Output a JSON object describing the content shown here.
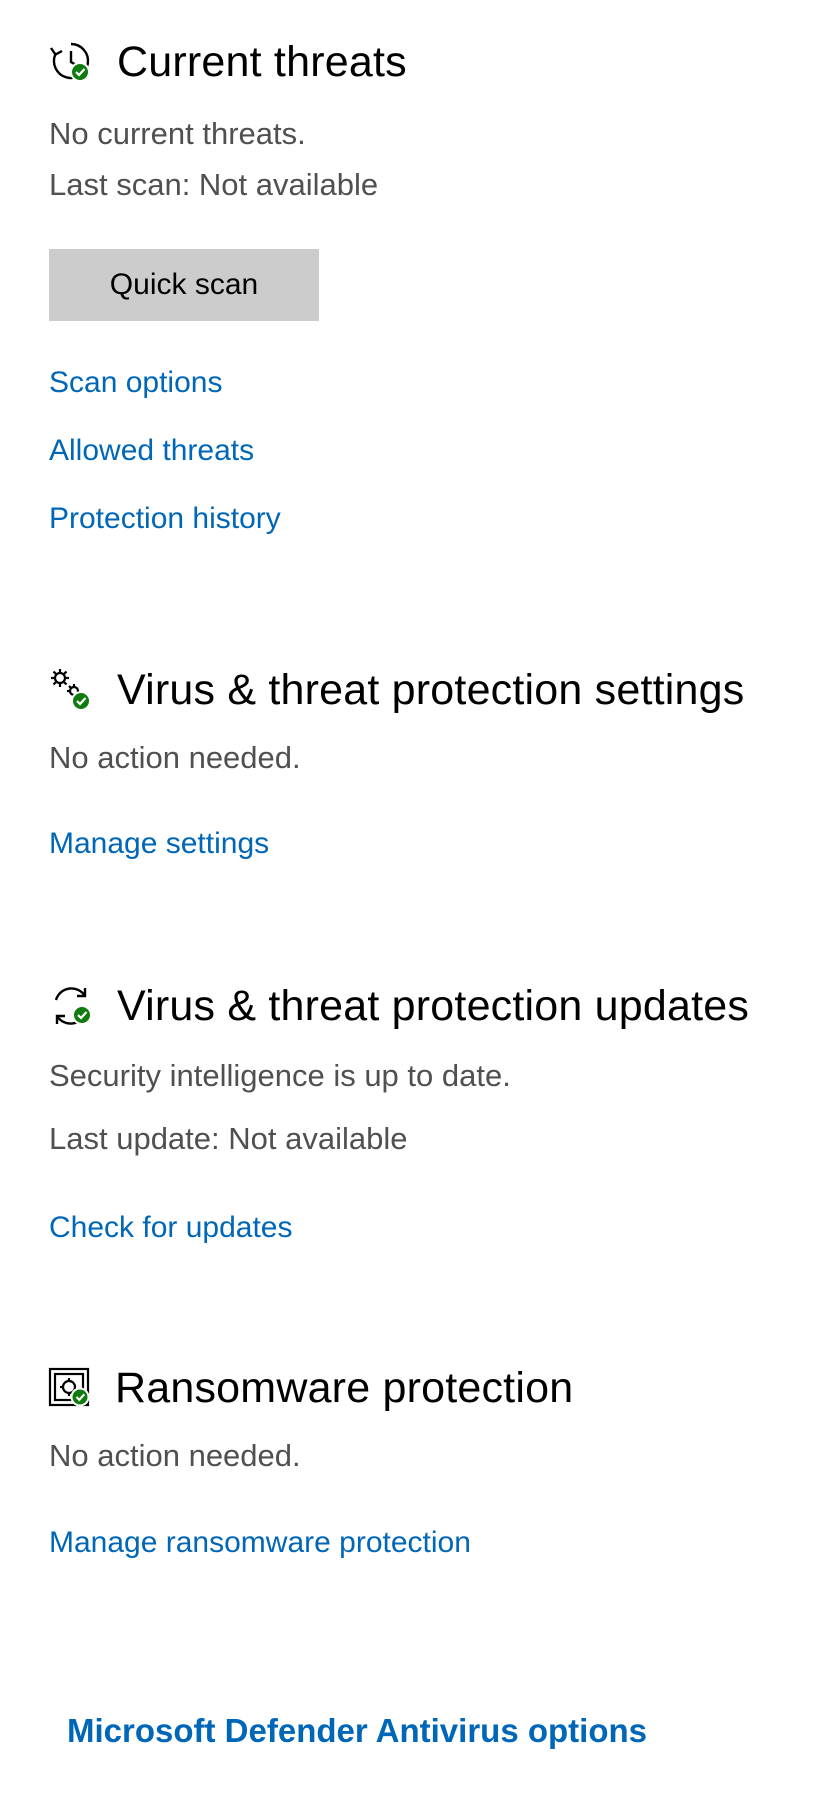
{
  "colors": {
    "link": "#0067b8",
    "check": "#107c10",
    "button_bg": "#cccccc",
    "secondary_text": "#505050"
  },
  "current_threats": {
    "icon": "history-check-icon",
    "title": "Current threats",
    "status": "No current threats.",
    "last_scan": "Last scan: Not available",
    "quick_scan_label": "Quick scan",
    "links": [
      "Scan options",
      "Allowed threats",
      "Protection history"
    ]
  },
  "settings": {
    "icon": "gears-check-icon",
    "title": "Virus & threat protection settings",
    "status": "No action needed.",
    "link": "Manage settings"
  },
  "updates": {
    "icon": "refresh-check-icon",
    "title": "Virus & threat protection updates",
    "status": "Security intelligence is up to date.",
    "last_update": "Last update: Not available",
    "link": "Check for updates"
  },
  "ransomware": {
    "icon": "vault-check-icon",
    "title": "Ransomware protection",
    "status": "No action needed.",
    "link": "Manage ransomware protection"
  },
  "footer": {
    "link": "Microsoft Defender Antivirus options"
  }
}
